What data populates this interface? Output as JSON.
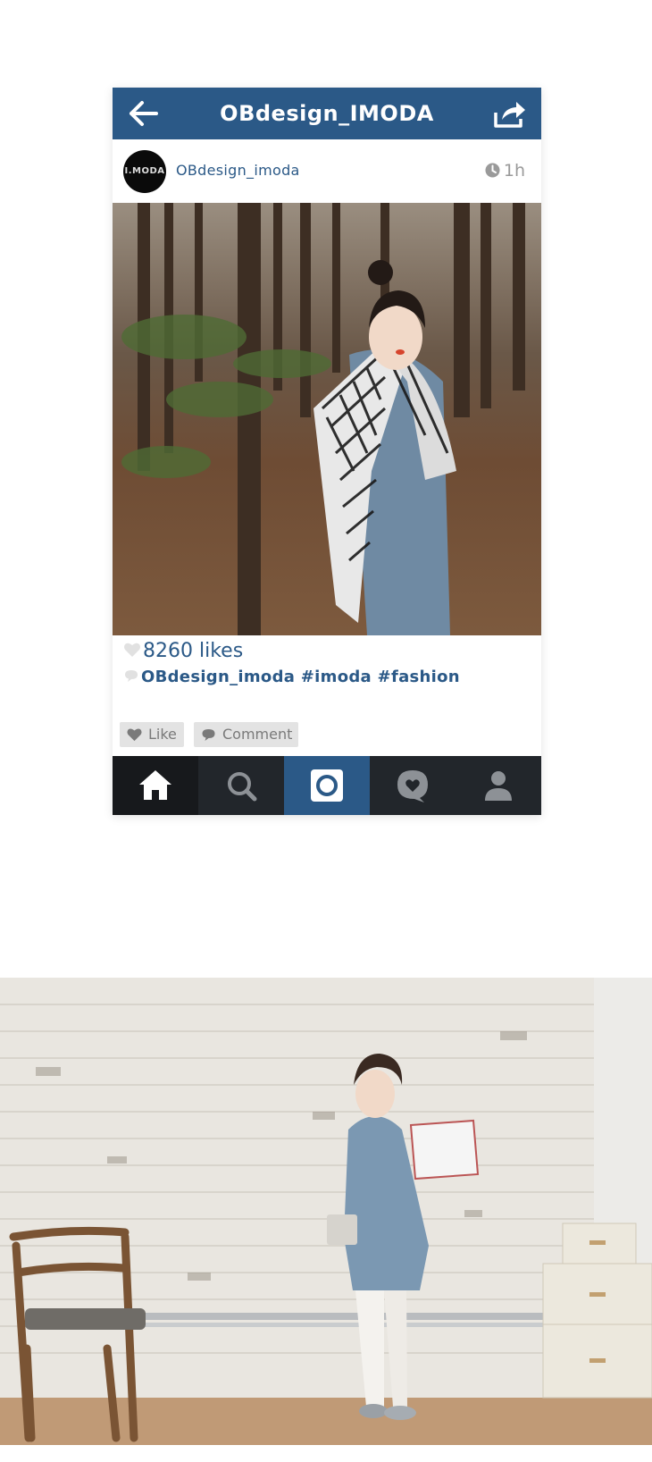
{
  "header": {
    "title": "OBdesign_IMODA",
    "back_icon": "arrow-left-icon",
    "share_icon": "share-icon",
    "bar_color": "#2b5987"
  },
  "post": {
    "avatar_text": "I.MODA",
    "username": "OBdesign_imoda",
    "time_ago": "1h",
    "likes": "8260 likes",
    "caption": "OBdesign_imoda  #imoda #fashion",
    "photo_description": "Model in a gingham shirt and denim-blue tunic standing in a pine forest"
  },
  "actions": {
    "like_label": "Like",
    "comment_label": "Comment"
  },
  "tabbar": {
    "items": [
      {
        "icon": "home-icon",
        "active": true
      },
      {
        "icon": "search-icon",
        "active": false
      },
      {
        "icon": "camera-icon",
        "active": false
      },
      {
        "icon": "activity-icon",
        "active": false
      },
      {
        "icon": "profile-icon",
        "active": false
      }
    ],
    "accent": "#2b5987",
    "dark": "#22262b"
  },
  "lower_photo": {
    "description": "Model in blue tunic and white leggings leaning on a white brick wall beside a wooden chair and stacked storage boxes"
  }
}
